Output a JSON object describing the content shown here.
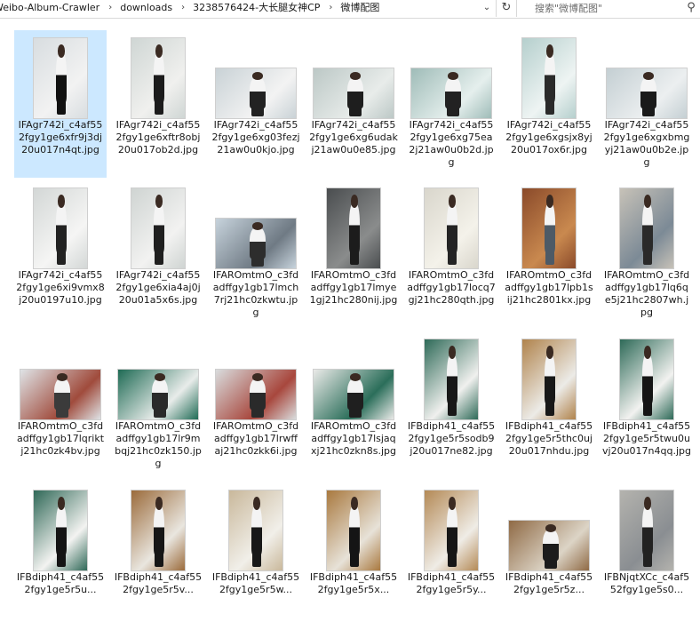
{
  "address": {
    "crumbs": [
      "Weibo-Album-Crawler",
      "downloads",
      "3238576424-大长腿女神CP",
      "微博配图"
    ],
    "separator": "›",
    "dropdown_icon": "chevron-down-icon",
    "refresh_icon": "refresh-icon"
  },
  "search": {
    "placeholder": "搜索\"微博配图\"",
    "icon": "search-icon"
  },
  "files": [
    {
      "name": "IFAgr742i_c4af552fgy1ge6xfr9j3dj20u017n4qt.jpg",
      "orientation": "portrait",
      "selected": true,
      "palette": [
        "#d8dde0",
        "#f2f2f2",
        "#111111"
      ]
    },
    {
      "name": "IFAgr742i_c4af552fgy1ge6xftr8obj20u017ob2d.jpg",
      "orientation": "portrait",
      "selected": false,
      "palette": [
        "#cfd6d4",
        "#f0f0ee",
        "#1b1b1b"
      ]
    },
    {
      "name": "IFAgr742i_c4af552fgy1ge6xg03fezj21aw0u0kjo.jpg",
      "orientation": "landscape",
      "selected": false,
      "palette": [
        "#c9d2d6",
        "#f3f3f3",
        "#222222"
      ]
    },
    {
      "name": "IFAgr742i_c4af552fgy1ge6xg6udakj21aw0u0e85.jpg",
      "orientation": "landscape",
      "selected": false,
      "palette": [
        "#bcc8c6",
        "#e8ecea",
        "#1e1e1e"
      ]
    },
    {
      "name": "IFAgr742i_c4af552fgy1ge6xg75ea2j21aw0u0b2d.jpg",
      "orientation": "landscape",
      "selected": false,
      "palette": [
        "#9fbcb8",
        "#e5efed",
        "#222222"
      ]
    },
    {
      "name": "IFAgr742i_c4af552fgy1ge6xgsjx8yj20u017ox6r.jpg",
      "orientation": "portrait",
      "selected": false,
      "palette": [
        "#b5cfcd",
        "#eef4f3",
        "#2a2a2a"
      ]
    },
    {
      "name": "IFAgr742i_c4af552fgy1ge6xgxbmgyj21aw0u0b2e.jpg",
      "orientation": "landscape",
      "selected": false,
      "palette": [
        "#c4cfd3",
        "#eceff0",
        "#1a1a1a"
      ]
    },
    {
      "name": "IFAgr742i_c4af552fgy1ge6xi9vmx8j20u0197u10.jpg",
      "orientation": "portrait",
      "selected": false,
      "palette": [
        "#d3d7d6",
        "#f5f5f4",
        "#222222"
      ]
    },
    {
      "name": "IFAgr742i_c4af552fgy1ge6xia4aj0j20u01a5x6s.jpg",
      "orientation": "portrait",
      "selected": false,
      "palette": [
        "#cfd4d2",
        "#f2f2f1",
        "#1f1f1f"
      ]
    },
    {
      "name": "IFAROmtmO_c3fdadffgy1gb17lmch7rj21hc0zkwtu.jpg",
      "orientation": "landscape",
      "selected": false,
      "palette": [
        "#c7d3dc",
        "#6f7a84",
        "#2d2d2d"
      ]
    },
    {
      "name": "IFAROmtmO_c3fdadffgy1gb17lmye1gj21hc280nij.jpg",
      "orientation": "portrait",
      "selected": false,
      "palette": [
        "#4a4d4f",
        "#8a8c8c",
        "#1c1c1c"
      ]
    },
    {
      "name": "IFAROmtmO_c3fdadffgy1gb17locq7gj21hc280qth.jpg",
      "orientation": "portrait",
      "selected": false,
      "palette": [
        "#d9d6cc",
        "#f4f2ea",
        "#242424"
      ]
    },
    {
      "name": "IFAROmtmO_c3fdadffgy1gb17lpb1sij21hc2801kx.jpg",
      "orientation": "portrait",
      "selected": false,
      "palette": [
        "#8a4a2a",
        "#c9894f",
        "#4d5a66"
      ]
    },
    {
      "name": "IFAROmtmO_c3fdadffgy1gb17lq6qe5j21hc2807wh.jpg",
      "orientation": "portrait",
      "selected": false,
      "palette": [
        "#c7c2b8",
        "#7c8a96",
        "#2a2a2a"
      ]
    },
    {
      "name": "IFAROmtmO_c3fdadffgy1gb17lqriktj21hc0zk4bv.jpg",
      "orientation": "landscape",
      "selected": false,
      "palette": [
        "#dfe3e6",
        "#a04b3c",
        "#3b3b3b"
      ]
    },
    {
      "name": "IFAROmtmO_c3fdadffgy1gb17lr9mbqj21hc0zk150.jpg",
      "orientation": "landscape",
      "selected": false,
      "palette": [
        "#1f6b55",
        "#e8ecea",
        "#2a2a2a"
      ]
    },
    {
      "name": "IFAROmtmO_c3fdadffgy1gb17lrwffaj21hc0zkk6i.jpg",
      "orientation": "landscape",
      "selected": false,
      "palette": [
        "#d9dcdd",
        "#a8473d",
        "#2a2a2a"
      ]
    },
    {
      "name": "IFAROmtmO_c3fdadffgy1gb17lsjaqxj21hc0zkn8s.jpg",
      "orientation": "landscape",
      "selected": false,
      "palette": [
        "#eaeae8",
        "#2b6e5a",
        "#1f1f1f"
      ]
    },
    {
      "name": "IFBdiph41_c4af552fgy1ge5r5sodb9j20u017ne82.jpg",
      "orientation": "portrait",
      "selected": false,
      "palette": [
        "#2e6a58",
        "#f0f0ee",
        "#181818"
      ]
    },
    {
      "name": "IFBdiph41_c4af552fgy1ge5r5thc0uj20u017nhdu.jpg",
      "orientation": "portrait",
      "selected": false,
      "palette": [
        "#b0834c",
        "#ecebe7",
        "#181818"
      ]
    },
    {
      "name": "IFBdiph41_c4af552fgy1ge5r5twu0uvj20u017n4qq.jpg",
      "orientation": "portrait",
      "selected": false,
      "palette": [
        "#2e6a58",
        "#f2f2f0",
        "#151515"
      ]
    },
    {
      "name": "IFBdiph41_c4af552fgy1ge5r5u...",
      "orientation": "portrait",
      "selected": false,
      "palette": [
        "#2f6857",
        "#f3f3f1",
        "#141414"
      ]
    },
    {
      "name": "IFBdiph41_c4af552fgy1ge5r5v...",
      "orientation": "portrait",
      "selected": false,
      "palette": [
        "#9b6b3b",
        "#e9e6df",
        "#161616"
      ]
    },
    {
      "name": "IFBdiph41_c4af552fgy1ge5r5w...",
      "orientation": "portrait",
      "selected": false,
      "palette": [
        "#c9b89b",
        "#f1efe9",
        "#181818"
      ]
    },
    {
      "name": "IFBdiph41_c4af552fgy1ge5r5x...",
      "orientation": "portrait",
      "selected": false,
      "palette": [
        "#a9793f",
        "#e7e2d8",
        "#151515"
      ]
    },
    {
      "name": "IFBdiph41_c4af552fgy1ge5r5y...",
      "orientation": "portrait",
      "selected": false,
      "palette": [
        "#b48a56",
        "#efece6",
        "#161616"
      ]
    },
    {
      "name": "IFBdiph41_c4af552fgy1ge5r5z...",
      "orientation": "landscape",
      "selected": false,
      "palette": [
        "#8f6a45",
        "#dcd4c6",
        "#1c1c1c"
      ]
    },
    {
      "name": "IFBNjqtXCc_c4af552fgy1ge5s0...",
      "orientation": "portrait",
      "selected": false,
      "palette": [
        "#b4b3ae",
        "#8a8e92",
        "#222222"
      ]
    }
  ]
}
